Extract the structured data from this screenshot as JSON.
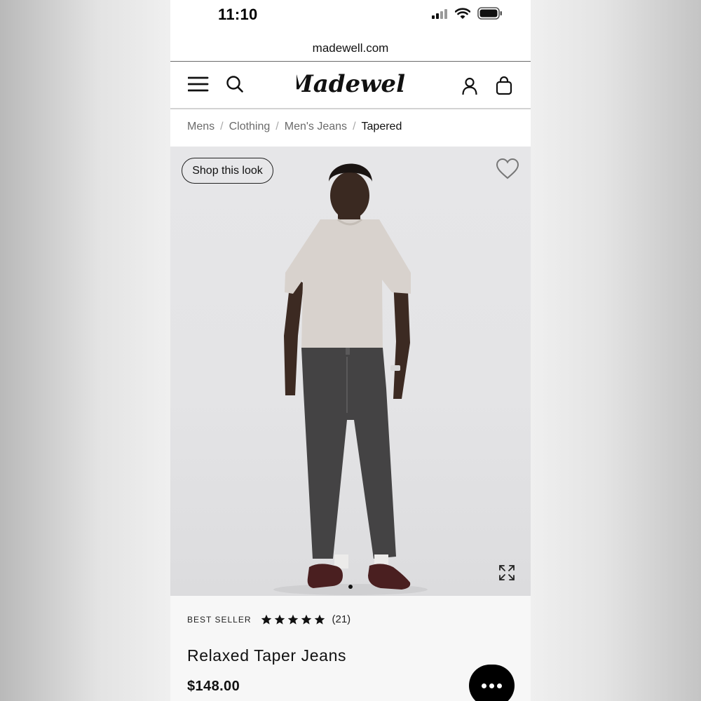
{
  "status_bar": {
    "time": "11:10"
  },
  "browser": {
    "url": "madewell.com"
  },
  "header": {
    "logo": "Madewell"
  },
  "breadcrumb": {
    "items": [
      "Mens",
      "Clothing",
      "Men's Jeans"
    ],
    "current": "Tapered",
    "separator": "/"
  },
  "product_image": {
    "shop_look_label": "Shop this look",
    "carousel": {
      "total": 1,
      "active": 1
    }
  },
  "product": {
    "badge": "BEST SELLER",
    "rating": 5,
    "review_count": "(21)",
    "title": "Relaxed Taper Jeans",
    "price": "$148.00"
  },
  "colors": {
    "text": "#111111",
    "chat_button": "#000000",
    "image_background": "#e4e4e6"
  },
  "icons": [
    "menu-icon",
    "search-icon",
    "account-icon",
    "bag-icon",
    "heart-icon",
    "expand-icon",
    "chat-icon"
  ]
}
